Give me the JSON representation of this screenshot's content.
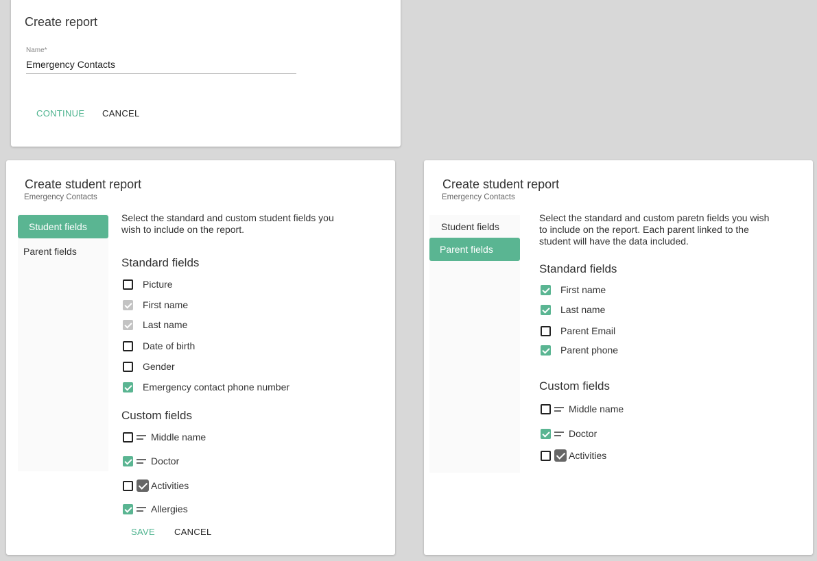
{
  "create_report": {
    "title": "Create report",
    "name_label": "Name*",
    "name_value": "Emergency Contacts",
    "continue_label": "CONTINUE",
    "cancel_label": "CANCEL"
  },
  "student_report": {
    "title": "Create student report",
    "subtitle": "Emergency Contacts",
    "nav": {
      "student_fields": "Student fields",
      "parent_fields": "Parent fields",
      "active": "student_fields"
    },
    "description": [
      "Select the standard and custom student fields you",
      "wish to include on the report."
    ],
    "standard_title": "Standard fields",
    "standard_fields": [
      {
        "label": "Picture",
        "state": "unchecked"
      },
      {
        "label": "First name",
        "state": "checked-disabled"
      },
      {
        "label": "Last name",
        "state": "checked-disabled"
      },
      {
        "label": "Date of birth",
        "state": "unchecked"
      },
      {
        "label": "Gender",
        "state": "unchecked"
      },
      {
        "label": "Emergency contact phone number",
        "state": "checked"
      }
    ],
    "custom_title": "Custom fields",
    "custom_fields": [
      {
        "label": "Middle name",
        "state": "unchecked",
        "type_icon": "text-lines-icon"
      },
      {
        "label": "Doctor",
        "state": "checked",
        "type_icon": "text-lines-icon"
      },
      {
        "label": "Activities",
        "state": "unchecked",
        "type_icon": "checkbox-type-icon"
      },
      {
        "label": "Allergies",
        "state": "checked",
        "type_icon": "text-lines-icon"
      }
    ],
    "save_label": "SAVE",
    "cancel_label": "CANCEL"
  },
  "parent_report": {
    "title": "Create student report",
    "subtitle": "Emergency Contacts",
    "nav": {
      "student_fields": "Student fields",
      "parent_fields": "Parent fields",
      "active": "parent_fields"
    },
    "description": [
      "Select the standard and custom paretn fields you wish",
      "to include on the report. Each parent linked to the",
      "student will have the data included."
    ],
    "standard_title": "Standard fields",
    "standard_fields": [
      {
        "label": "First name",
        "state": "checked"
      },
      {
        "label": "Last name",
        "state": "checked"
      },
      {
        "label": "Parent Email",
        "state": "unchecked"
      },
      {
        "label": "Parent phone",
        "state": "checked"
      }
    ],
    "custom_title": "Custom fields",
    "custom_fields": [
      {
        "label": "Middle name",
        "state": "unchecked",
        "type_icon": "text-lines-icon"
      },
      {
        "label": "Doctor",
        "state": "checked",
        "type_icon": "text-lines-icon"
      },
      {
        "label": "Activities",
        "state": "unchecked",
        "type_icon": "checkbox-type-icon"
      }
    ]
  },
  "colors": {
    "accent": "#5ab592",
    "background": "#d8d8d8",
    "card": "#ffffff"
  }
}
